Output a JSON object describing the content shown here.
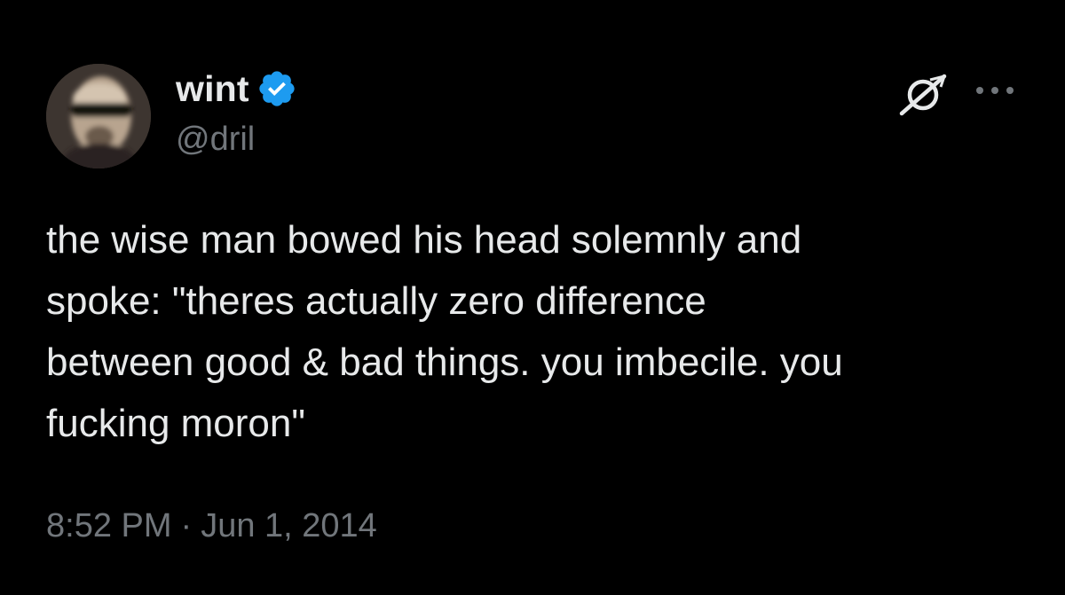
{
  "author": {
    "display_name": "wint",
    "handle": "@dril",
    "verified": true,
    "verified_color": "#1d9bf0"
  },
  "tweet": {
    "text": "the wise man bowed his head solemnly and\nspoke: \"theres actually zero difference\nbetween good & bad things. you imbecile. you\nfucking moron\"",
    "time": "8:52 PM",
    "separator": "·",
    "date": "Jun 1, 2014"
  },
  "icons": {
    "avatar": "avatar",
    "verified": "verified-badge-icon",
    "grok": "grok-icon",
    "more": "more-options-icon"
  },
  "colors": {
    "background": "#000000",
    "primary_text": "#e7e9ea",
    "secondary_text": "#71767b"
  }
}
